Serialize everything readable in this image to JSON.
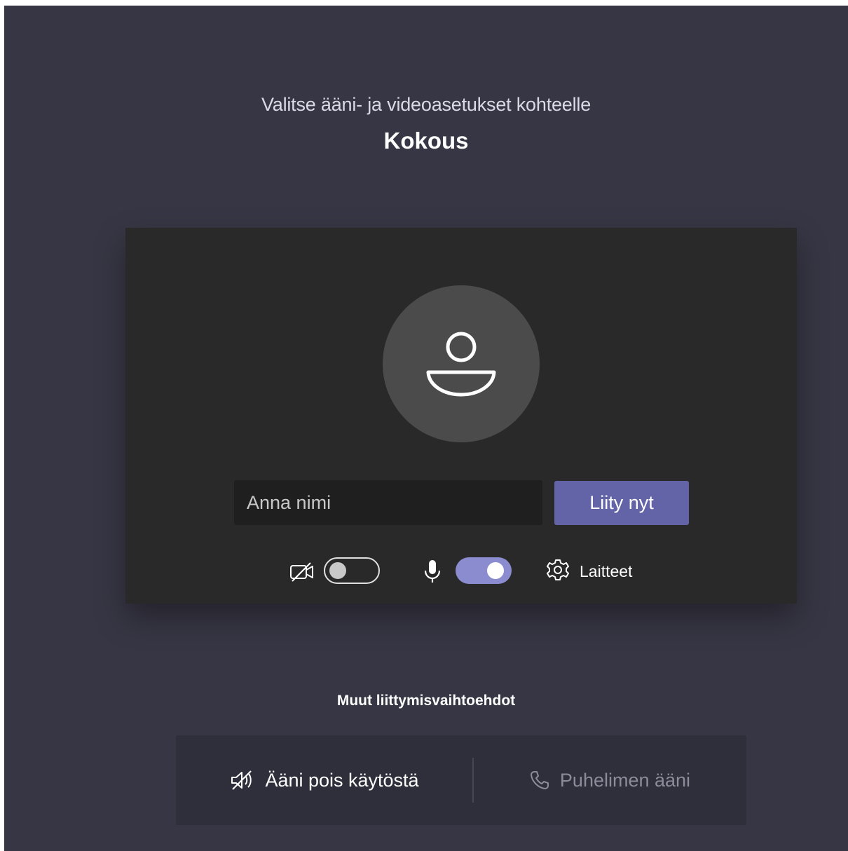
{
  "header": {
    "subtitle": "Valitse ääni- ja videoasetukset kohteelle",
    "meeting_title": "Kokous"
  },
  "prejoin": {
    "avatar_icon": "person-icon",
    "name_input": {
      "placeholder": "Anna nimi",
      "value": ""
    },
    "join_button_label": "Liity nyt",
    "camera": {
      "icon": "camera-off-icon",
      "enabled": false
    },
    "microphone": {
      "icon": "microphone-icon",
      "enabled": true
    },
    "devices_label": "Laitteet",
    "devices_icon": "gear-icon"
  },
  "other_options": {
    "heading": "Muut liittymisvaihtoehdot",
    "audio_off_label": "Ääni pois käytöstä",
    "audio_off_icon": "speaker-off-icon",
    "phone_audio_label": "Puhelimen ääni",
    "phone_audio_icon": "phone-icon"
  },
  "colors": {
    "background": "#373644",
    "card": "#292929",
    "accent": "#6264a7",
    "toggle_on": "#8a8ccf"
  }
}
